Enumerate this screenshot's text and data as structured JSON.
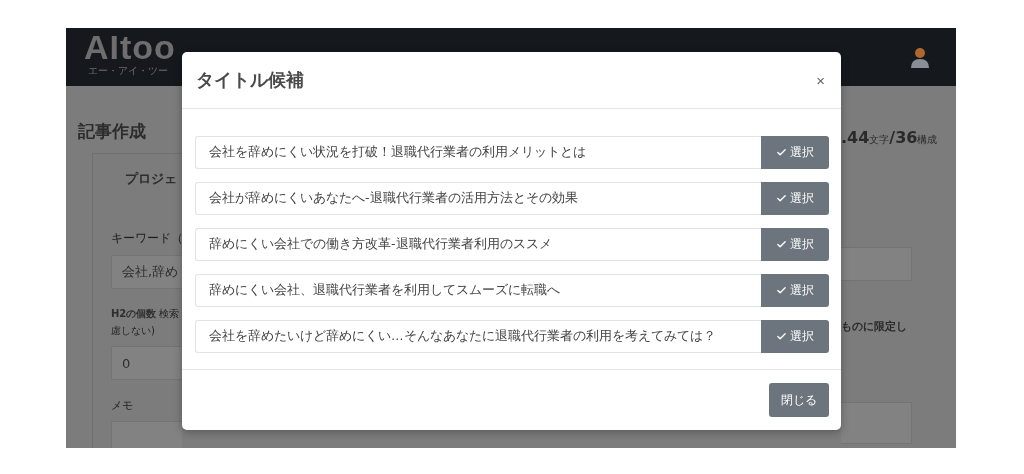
{
  "header": {
    "logo": "AItoo",
    "logo_tagline": "エー・アイ・ツー"
  },
  "page": {
    "title": "記事作成",
    "section": "プロジェ",
    "keyword_label": "キーワード（",
    "keyword_value": "会社,辞め",
    "h2_label": "H2の個数",
    "h2_hint": "検索",
    "h2_hint_cont": "慮しない)",
    "h2_value": "0",
    "memo_label": "メモ",
    "stats": "**.44**文字**/36**構成",
    "option_text": "ものに限定し"
  },
  "modal": {
    "title": "タイトル候補",
    "close": "×",
    "candidates": [
      {
        "title": "会社を辞めにくい状況を打破！退職代行業者の利用メリットとは",
        "button": "選択"
      },
      {
        "title": "会社が辞めにくいあなたへ-退職代行業者の活用方法とその効果",
        "button": "選択"
      },
      {
        "title": "辞めにくい会社での働き方改革-退職代行業者利用のススメ",
        "button": "選択"
      },
      {
        "title": "辞めにくい会社、退職代行業者を利用してスムーズに転職へ",
        "button": "選択"
      },
      {
        "title": "会社を辞めたいけど辞めにくい…そんなあなたに退職代行業者の利用を考えてみては？",
        "button": "選択"
      }
    ],
    "footer_button": "閉じる"
  }
}
